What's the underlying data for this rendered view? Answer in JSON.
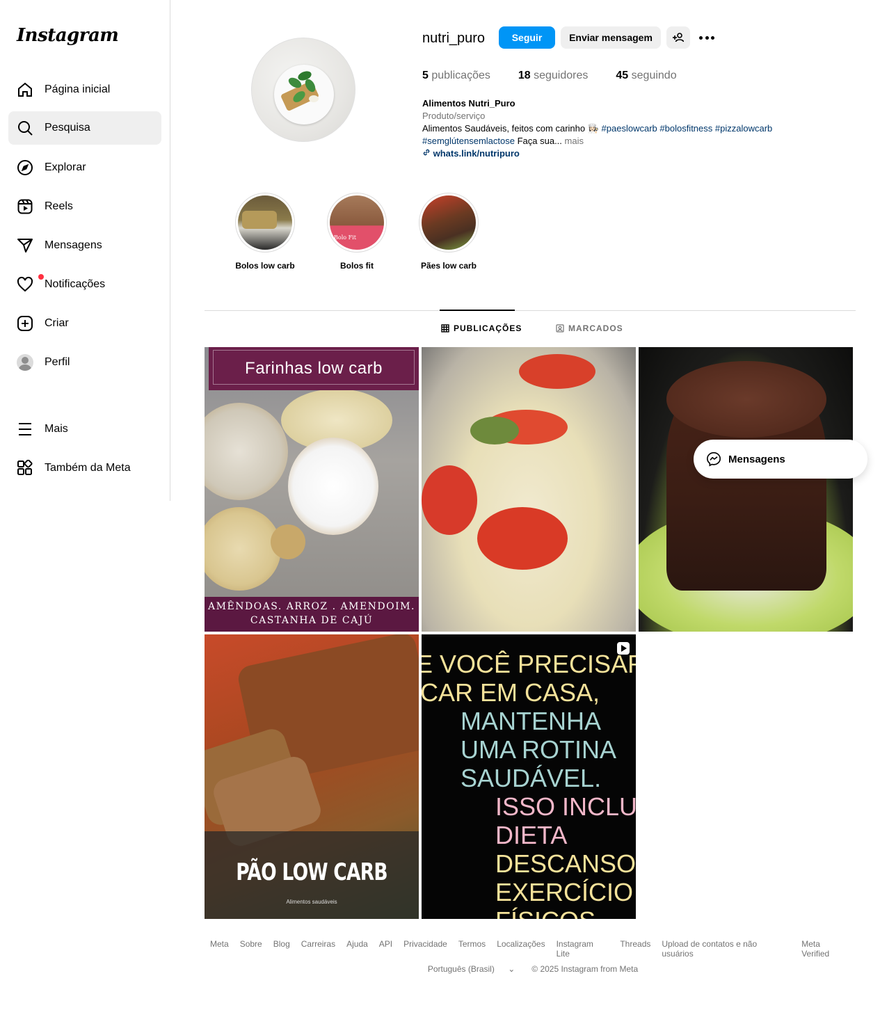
{
  "brand": {
    "logo_text": "Instagram"
  },
  "sidebar": {
    "items": [
      {
        "label": "Página inicial",
        "icon": "home-icon"
      },
      {
        "label": "Pesquisa",
        "icon": "search-icon"
      },
      {
        "label": "Explorar",
        "icon": "compass-icon"
      },
      {
        "label": "Reels",
        "icon": "reels-icon"
      },
      {
        "label": "Mensagens",
        "icon": "send-icon"
      },
      {
        "label": "Notificações",
        "icon": "heart-icon"
      },
      {
        "label": "Criar",
        "icon": "plus-square-icon"
      },
      {
        "label": "Perfil",
        "icon": "avatar"
      },
      {
        "label": "Mais",
        "icon": "menu-icon"
      },
      {
        "label": "Também da Meta",
        "icon": "meta-apps-icon"
      }
    ],
    "active": "Pesquisa"
  },
  "profile": {
    "username": "nutri_puro",
    "follow_label": "Seguir",
    "message_label": "Enviar mensagem",
    "posts_count": "5",
    "posts_label": "publicações",
    "followers_count": "18",
    "followers_label": "seguidores",
    "following_count": "45",
    "following_label": "seguindo",
    "bio": {
      "name": "Alimentos Nutri_Puro",
      "category": "Produto/serviço",
      "text": "Alimentos Saudáveis, feitos com carinho 👩🏻‍🍳",
      "hashtags": [
        "#paeslowcarb",
        "#bolosfitness",
        "#pizzalowcarb",
        "#semglútensemlactose"
      ],
      "text_cont": "Faça sua...",
      "more": "mais",
      "link": "whats.link/nutripuro"
    }
  },
  "highlights": [
    {
      "label": "Bolos low carb"
    },
    {
      "label": "Bolos fit",
      "overlay": "Bolo Fit"
    },
    {
      "label": "Pães low carb"
    }
  ],
  "tabs": [
    {
      "label": "PUBLICAÇÕES",
      "active": true
    },
    {
      "label": "MARCADOS",
      "active": false
    }
  ],
  "posts": [
    {
      "title": "Farinhas low carb",
      "caption_line1": "AMÊNDOAS. ARROZ . AMENDOIM.",
      "caption_line2": "CASTANHA DE CAJÚ"
    },
    {
      "kind": "pizza"
    },
    {
      "kind": "cake"
    },
    {
      "title": "PÃO LOW CARB",
      "subtitle": "Alimentos saudáveis"
    },
    {
      "lines": [
        "E VOCÊ PRECISAR",
        "CAR EM CASA,",
        "MANTENHA",
        "UMA ROTINA",
        "SAUDÁVEL.",
        "ISSO INCLU",
        "DIETA",
        "DESCANSO",
        "EXERCÍCIO",
        "FÍSICOS"
      ]
    }
  ],
  "floating_messages": {
    "label": "Mensagens"
  },
  "footer": {
    "links": [
      "Meta",
      "Sobre",
      "Blog",
      "Carreiras",
      "Ajuda",
      "API",
      "Privacidade",
      "Termos",
      "Localizações",
      "Instagram Lite",
      "Threads",
      "Upload de contatos e não usuários",
      "Meta Verified"
    ],
    "language": "Português (Brasil)",
    "copyright": "© 2025 Instagram from Meta"
  },
  "colors": {
    "accent": "#0095f6",
    "link": "#00376b",
    "notification": "#ff3040",
    "muted": "#737373"
  }
}
